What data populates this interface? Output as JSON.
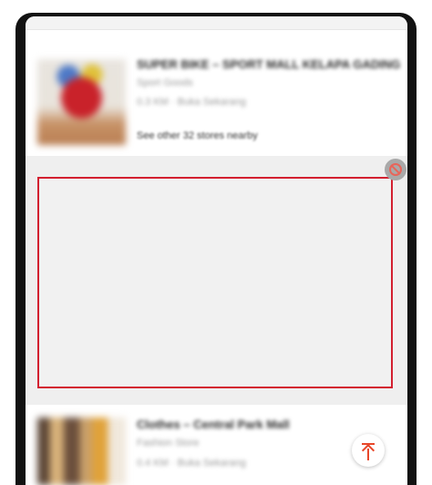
{
  "listings": [
    {
      "title": "SUPER BIKE – SPORT MALL KELAPA GADING",
      "subtitle": "Sport Goods",
      "meta": "0.3 KM · Buka Sekarang",
      "nearby": "See other 32 stores nearby"
    },
    {
      "title": "Clothes – Central Park Mall",
      "subtitle": "Fashion Store",
      "meta": "0.4 KM · Buka Sekarang"
    }
  ],
  "ad_slot": {
    "border_color": "#d32030",
    "background": "#f1f1f1"
  },
  "icons": {
    "ad_block": "block-icon",
    "scroll_to_top": "arrow-up-to-line-icon"
  },
  "colors": {
    "accent": "#e8472a"
  }
}
